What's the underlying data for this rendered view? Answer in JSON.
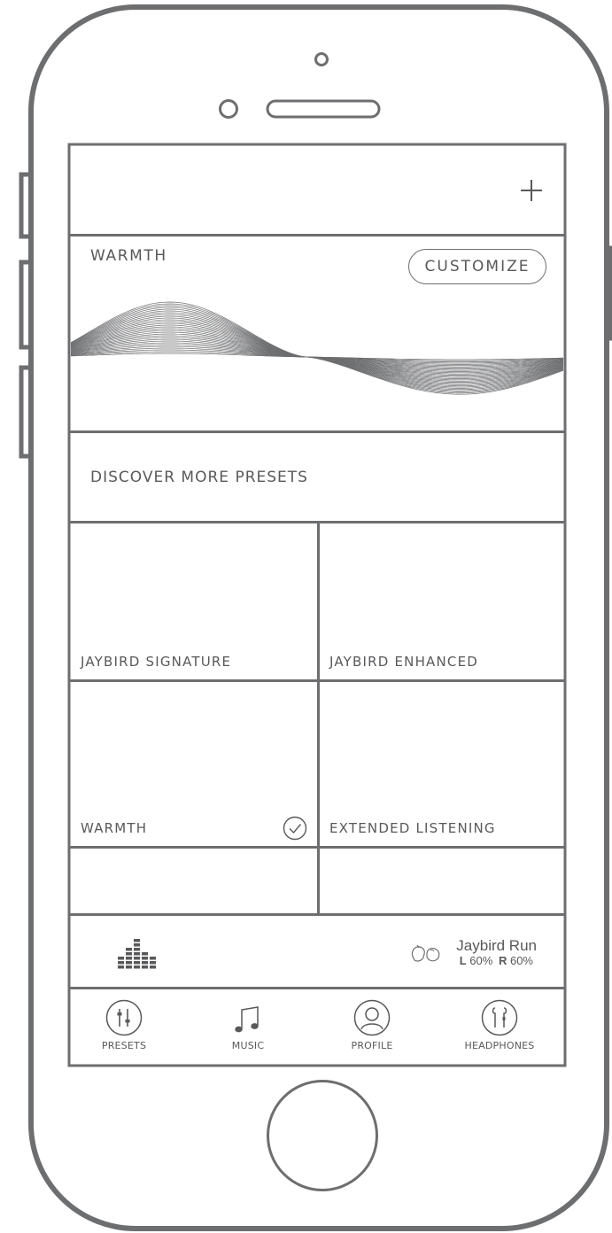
{
  "header": {
    "add_icon": "plus-icon"
  },
  "current_preset": {
    "name": "WARMTH",
    "customize_label": "CUSTOMIZE"
  },
  "discover": {
    "label": "DISCOVER MORE PRESETS"
  },
  "presets": [
    {
      "label": "JAYBIRD SIGNATURE",
      "selected": false
    },
    {
      "label": "JAYBIRD ENHANCED",
      "selected": false
    },
    {
      "label": "WARMTH",
      "selected": true
    },
    {
      "label": "EXTENDED LISTENING",
      "selected": false
    }
  ],
  "status_bar": {
    "eq_icon": "equalizer-bars-icon",
    "device_name": "Jaybird Run",
    "left_label": "L",
    "left_battery": "60%",
    "right_label": "R",
    "right_battery": "60%"
  },
  "tabs": [
    {
      "label": "PRESETS",
      "icon": "sliders-icon"
    },
    {
      "label": "MUSIC",
      "icon": "music-note-icon"
    },
    {
      "label": "PROFILE",
      "icon": "user-icon"
    },
    {
      "label": "HEADPHONES",
      "icon": "earbuds-icon"
    }
  ],
  "colors": {
    "outline": "#6d6e70",
    "text": "#58595b",
    "background": "#ffffff"
  }
}
